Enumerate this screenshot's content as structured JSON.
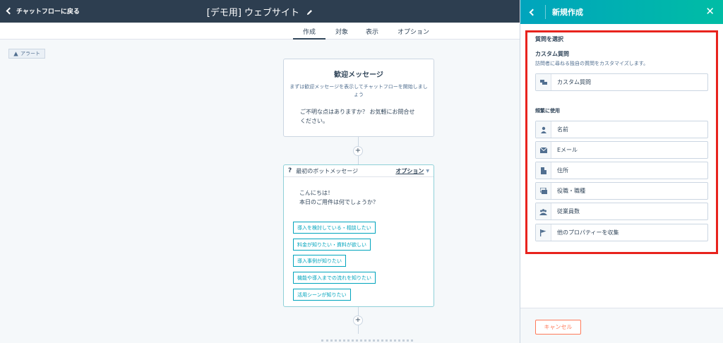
{
  "topbar": {
    "back_label": "チャットフローに戻る",
    "title": "[デモ用] ウェブサイト"
  },
  "tabs": [
    "作成",
    "対象",
    "表示",
    "オプション"
  ],
  "canvas": {
    "alert_label": "アラート",
    "welcome": {
      "title": "歓迎メッセージ",
      "subtitle": "まずは歓迎メッセージを表示してチャットフローを開始しましょう",
      "message": "ご不明な点はありますか？ お気軽にお問合せください。"
    },
    "bot": {
      "header": "最初のボットメッセージ",
      "options_label": "オプション",
      "message_line1": "こんにちは！",
      "message_line2": "本日のご用件は何でしょうか？",
      "choices": [
        "導入を検討している・相談したい",
        "料金が知りたい・資料が欲しい",
        "導入事例が知りたい",
        "機能や導入までの流れを知りたい",
        "活用シーンが知りたい"
      ]
    }
  },
  "panel": {
    "title": "新規作成",
    "select_question": "質問を選択",
    "custom_title": "カスタム質問",
    "custom_desc": "訪問者に尋ねる独自の質問をカスタマイズします。",
    "custom_item": "カスタム質問",
    "frequent_title": "頻繁に使用",
    "frequent_items": [
      "名前",
      "Eメール",
      "住所",
      "役職・職種",
      "従業員数",
      "他のプロパティーを収集"
    ],
    "cancel_label": "キャンセル"
  },
  "colors": {
    "header_dark": "#2d3e50",
    "teal": "#00a4bd",
    "highlight_red": "#e8231d",
    "cancel_orange": "#ff7a59"
  }
}
